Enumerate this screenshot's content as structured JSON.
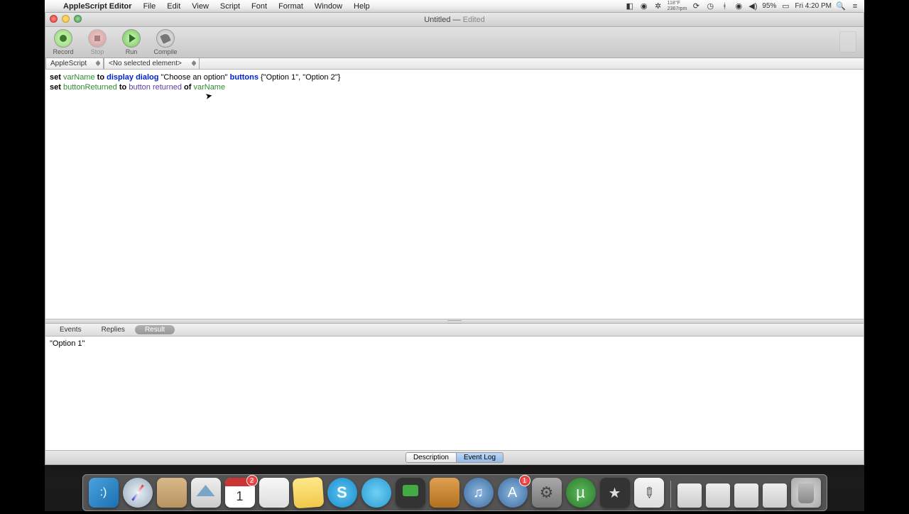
{
  "menubar": {
    "app_name": "AppleScript Editor",
    "items": [
      "File",
      "Edit",
      "View",
      "Script",
      "Font",
      "Format",
      "Window",
      "Help"
    ],
    "right": {
      "temp": "118°F",
      "time_sub": "2367rpm",
      "battery_pct": "95%",
      "clock": "Fri 4:20 PM"
    }
  },
  "window": {
    "title": "Untitled",
    "subtitle": "Edited"
  },
  "toolbar": {
    "record": "Record",
    "stop": "Stop",
    "run": "Run",
    "compile": "Compile"
  },
  "navbar": {
    "language": "AppleScript",
    "element": "<No selected element>"
  },
  "code": {
    "line1": {
      "set": "set",
      "var": "varName",
      "to": "to",
      "cmd": "display dialog",
      "str": "\"Choose an option\"",
      "buttons": "buttons",
      "list": "{\"Option 1\", \"Option 2\"}"
    },
    "line2": {
      "set": "set",
      "var": "buttonReturned",
      "to": "to",
      "prop": "button returned",
      "of": "of",
      "var2": "varName"
    }
  },
  "tabs": {
    "events": "Events",
    "replies": "Replies",
    "result": "Result"
  },
  "result_text": "\"Option 1\"",
  "bottom": {
    "description": "Description",
    "eventlog": "Event Log"
  },
  "dock_badges": {
    "cal": "2",
    "appstore": "1"
  }
}
